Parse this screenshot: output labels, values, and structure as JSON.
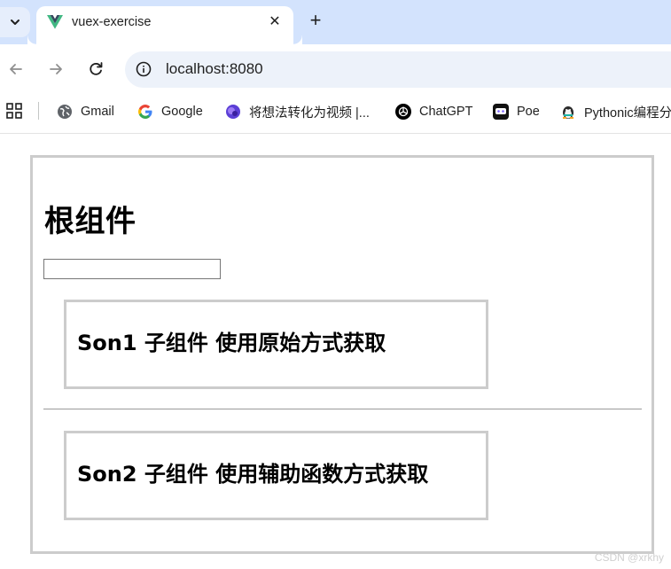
{
  "browser": {
    "tab": {
      "title": "vuex-exercise",
      "close_glyph": "✕"
    },
    "new_tab_glyph": "+",
    "address": {
      "url": "localhost:8080"
    },
    "bookmarks": [
      {
        "label": "Gmail",
        "icon": "globe-icon"
      },
      {
        "label": "Google",
        "icon": "google-icon"
      },
      {
        "label": "将想法转化为视频 |...",
        "icon": "video-ai-icon"
      },
      {
        "label": "ChatGPT",
        "icon": "chatgpt-icon"
      },
      {
        "label": "Poe",
        "icon": "poe-icon"
      },
      {
        "label": "Pythonic编程分",
        "icon": "pythonic-icon"
      }
    ]
  },
  "page": {
    "root_title": "根组件",
    "input_value": "",
    "son1_title": "Son1 子组件 使用原始方式获取",
    "son2_title": "Son2 子组件 使用辅助函数方式获取"
  },
  "watermark": "CSDN @xrkhy",
  "colors": {
    "tabstrip": "#d3e3fd",
    "omnibox": "#edf2fa",
    "box_border": "#cccccc"
  }
}
